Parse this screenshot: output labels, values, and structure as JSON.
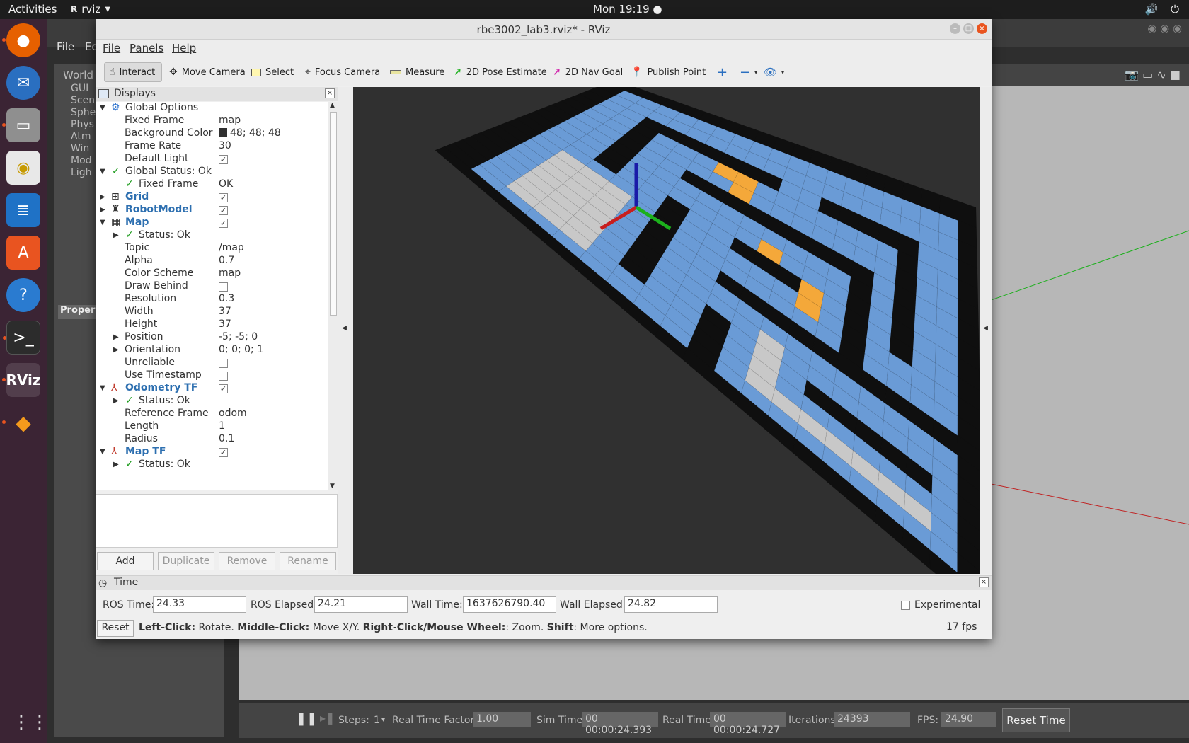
{
  "topbar": {
    "activities": "Activities",
    "app": "rviz",
    "clock": "Mon 19:19"
  },
  "gazebo": {
    "menu": {
      "file": "File",
      "edit": "Ed"
    },
    "left": {
      "world": "World",
      "items": [
        "GUI",
        "Scen",
        "Sphe",
        "Phys",
        "Atm",
        "Win",
        "Mod",
        "Ligh"
      ],
      "properties": "Proper"
    },
    "status": {
      "steps_label": "Steps:",
      "steps_value": "1",
      "rtf_label": "Real Time Factor:",
      "rtf_value": "1.00",
      "sim_label": "Sim Time:",
      "sim_value": "00 00:00:24.393",
      "real_label": "Real Time:",
      "real_value": "00 00:00:24.727",
      "iter_label": "Iterations:",
      "iter_value": "24393",
      "fps_label": "FPS:",
      "fps_value": "24.90",
      "reset": "Reset Time"
    }
  },
  "rviz": {
    "title": "rbe3002_lab3.rviz* - RViz",
    "menu": {
      "file": "File",
      "panels": "Panels",
      "help": "Help"
    },
    "toolbar": {
      "interact": "Interact",
      "move_camera": "Move Camera",
      "select": "Select",
      "focus_camera": "Focus Camera",
      "measure": "Measure",
      "pose": "2D Pose Estimate",
      "nav_goal": "2D Nav Goal",
      "publish_point": "Publish Point"
    },
    "displays": {
      "title": "Displays",
      "rows": {
        "global_options": "Global Options",
        "fixed_frame": "Fixed Frame",
        "fixed_frame_val": "map",
        "bg_color": "Background Color",
        "bg_color_val": "48; 48; 48",
        "frame_rate": "Frame Rate",
        "frame_rate_val": "30",
        "default_light": "Default Light",
        "global_status": "Global Status: Ok",
        "gs_fixed_frame": "Fixed Frame",
        "gs_fixed_frame_val": "OK",
        "grid": "Grid",
        "robot_model": "RobotModel",
        "map": "Map",
        "map_status": "Status: Ok",
        "topic": "Topic",
        "topic_val": "/map",
        "alpha": "Alpha",
        "alpha_val": "0.7",
        "color_scheme": "Color Scheme",
        "color_scheme_val": "map",
        "draw_behind": "Draw Behind",
        "resolution": "Resolution",
        "resolution_val": "0.3",
        "width": "Width",
        "width_val": "37",
        "height": "Height",
        "height_val": "37",
        "position": "Position",
        "position_val": "-5; -5; 0",
        "orientation": "Orientation",
        "orientation_val": "0; 0; 0; 1",
        "unreliable": "Unreliable",
        "use_timestamp": "Use Timestamp",
        "odom_tf": "Odometry TF",
        "odom_status": "Status: Ok",
        "ref_frame": "Reference Frame",
        "ref_frame_val": "odom",
        "length": "Length",
        "length_val": "1",
        "radius": "Radius",
        "radius_val": "0.1",
        "map_tf": "Map TF",
        "maptf_status": "Status: Ok"
      },
      "buttons": {
        "add": "Add",
        "duplicate": "Duplicate",
        "remove": "Remove",
        "rename": "Rename"
      }
    },
    "time": {
      "title": "Time",
      "ros_time_label": "ROS Time:",
      "ros_time": "24.33",
      "ros_elapsed_label": "ROS Elapsed:",
      "ros_elapsed": "24.21",
      "wall_time_label": "Wall Time:",
      "wall_time": "1637626790.40",
      "wall_elapsed_label": "Wall Elapsed:",
      "wall_elapsed": "24.82",
      "experimental": "Experimental",
      "reset": "Reset",
      "help_left": "Left-Click:",
      "help_left_txt": " Rotate. ",
      "help_mid": "Middle-Click:",
      "help_mid_txt": " Move X/Y. ",
      "help_right": "Right-Click/Mouse Wheel:",
      "help_right_txt": ": Zoom. ",
      "help_shift": "Shift",
      "help_shift_txt": ": More options.",
      "fps": "17 fps"
    }
  },
  "colors": {
    "accent": "#e9541f",
    "map_free": "#c8c8c8",
    "map_wall": "#0f0f0f",
    "map_inflate": "#6a9bd6",
    "path": "#f4a83a",
    "bg3d": "#303030"
  }
}
